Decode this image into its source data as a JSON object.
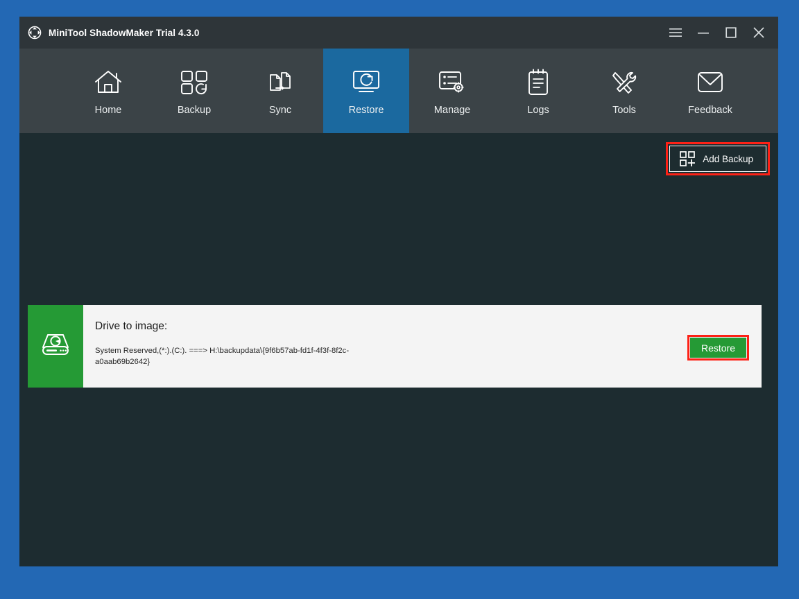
{
  "window": {
    "title": "MiniTool ShadowMaker Trial 4.3.0",
    "logo_icon": "shadowmaker-logo-icon",
    "controls": {
      "menu": "hamburger-menu-icon",
      "minimize": "minimize-icon",
      "maximize": "maximize-icon",
      "close": "close-icon"
    }
  },
  "nav": {
    "active": "Restore",
    "items": [
      {
        "label": "Home",
        "icon": "home-icon"
      },
      {
        "label": "Backup",
        "icon": "backup-icon"
      },
      {
        "label": "Sync",
        "icon": "sync-icon"
      },
      {
        "label": "Restore",
        "icon": "restore-icon"
      },
      {
        "label": "Manage",
        "icon": "manage-icon"
      },
      {
        "label": "Logs",
        "icon": "logs-icon"
      },
      {
        "label": "Tools",
        "icon": "tools-icon"
      },
      {
        "label": "Feedback",
        "icon": "feedback-icon"
      }
    ]
  },
  "toolbar": {
    "add_backup_label": "Add Backup",
    "add_backup_icon": "add-squares-plus-icon"
  },
  "backup_card": {
    "thumb_icon": "hard-drive-icon",
    "title": "Drive to image:",
    "path": " System Reserved,(*:).(C:). ===> H:\\backupdata\\{9f6b57ab-fd1f-4f3f-8f2c-a0aab69b2642}",
    "restore_label": "Restore"
  },
  "colors": {
    "desktop": "#2368b4",
    "title_bar": "#2e3539",
    "nav_bar": "#3b4347",
    "nav_active": "#1b699f",
    "content_bg": "#1d2c30",
    "card_bg": "#f4f4f4",
    "accent_green": "#259a35",
    "annotation_red": "#fd2116"
  }
}
